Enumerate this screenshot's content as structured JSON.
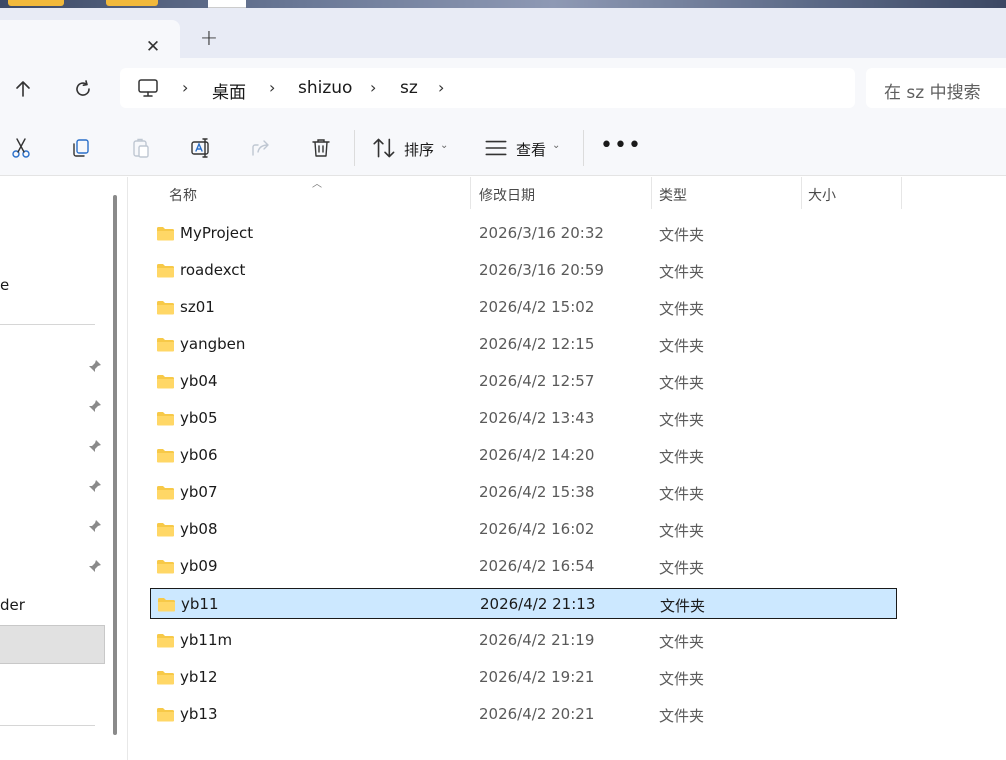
{
  "tab": {
    "close_glyph": "✕",
    "new_tab_glyph": "+"
  },
  "address": {
    "crumbs": [
      "桌面",
      "shizuo",
      "sz"
    ],
    "chevron": "›",
    "search_placeholder": "在 sz 中搜索"
  },
  "toolbar": {
    "sort_label": "排序",
    "view_label": "查看",
    "more_label": "•••",
    "caret": "⌄"
  },
  "navpane": {
    "fragment_top": "e",
    "fragment_bottom": "der"
  },
  "columns": {
    "name": "名称",
    "modified": "修改日期",
    "type": "类型",
    "size": "大小"
  },
  "files": [
    {
      "name": "MyProject",
      "modified": "2026/3/16 20:32",
      "type": "文件夹"
    },
    {
      "name": "roadexct",
      "modified": "2026/3/16 20:59",
      "type": "文件夹"
    },
    {
      "name": "sz01",
      "modified": "2026/4/2 15:02",
      "type": "文件夹"
    },
    {
      "name": "yangben",
      "modified": "2026/4/2 12:15",
      "type": "文件夹"
    },
    {
      "name": "yb04",
      "modified": "2026/4/2 12:57",
      "type": "文件夹"
    },
    {
      "name": "yb05",
      "modified": "2026/4/2 13:43",
      "type": "文件夹"
    },
    {
      "name": "yb06",
      "modified": "2026/4/2 14:20",
      "type": "文件夹"
    },
    {
      "name": "yb07",
      "modified": "2026/4/2 15:38",
      "type": "文件夹"
    },
    {
      "name": "yb08",
      "modified": "2026/4/2 16:02",
      "type": "文件夹"
    },
    {
      "name": "yb09",
      "modified": "2026/4/2 16:54",
      "type": "文件夹"
    },
    {
      "name": "yb11",
      "modified": "2026/4/2 21:13",
      "type": "文件夹",
      "selected": true
    },
    {
      "name": "yb11m",
      "modified": "2026/4/2 21:19",
      "type": "文件夹"
    },
    {
      "name": "yb12",
      "modified": "2026/4/2 19:21",
      "type": "文件夹"
    },
    {
      "name": "yb13",
      "modified": "2026/4/2 20:21",
      "type": "文件夹"
    }
  ],
  "colors": {
    "accent_selection": "#cce8ff",
    "folder": "#f7c948"
  }
}
